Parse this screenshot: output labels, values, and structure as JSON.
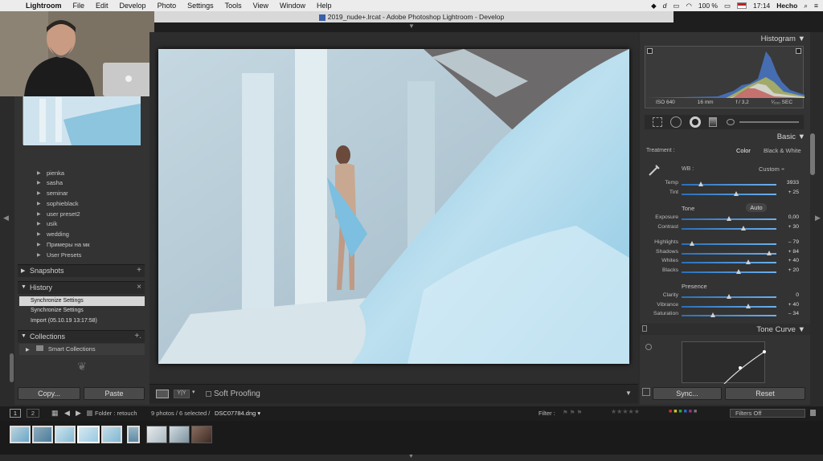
{
  "menubar": {
    "items": [
      "Lightroom",
      "File",
      "Edit",
      "Develop",
      "Photo",
      "Settings",
      "Tools",
      "View",
      "Window",
      "Help"
    ],
    "battery": "100 %",
    "time": "17:14",
    "user": "Hecho"
  },
  "window": {
    "title": "2019_nude+.lrcat - Adobe Photoshop Lightroom - Develop"
  },
  "left_panel": {
    "presets": [
      "pienka",
      "sasha",
      "seminar",
      "sophieblack",
      "user preset2",
      "usik",
      "wedding",
      "Примеры на мк",
      "User Presets"
    ],
    "snapshots": {
      "label": "Snapshots",
      "action": "+"
    },
    "history": {
      "label": "History",
      "action": "×",
      "items": [
        "Synchronize Settings",
        "Synchronize Settings",
        "Import (05.10.19 13:17:58)"
      ]
    },
    "collections": {
      "label": "Collections",
      "action": "+.",
      "items": [
        "Smart Collections"
      ]
    },
    "copy_label": "Copy...",
    "paste_label": "Paste"
  },
  "center": {
    "soft_proofing_label": "Soft Proofing",
    "yy_label": "Y|Y"
  },
  "right_panel": {
    "histogram_label": "Histogram",
    "histinfo": [
      "ISO 640",
      "16 mm",
      "f / 3,2",
      "¹⁄₂₀₀ SEC"
    ],
    "basic_label": "Basic",
    "treatment_label": "Treatment :",
    "treatment_color": "Color",
    "treatment_bw": "Black & White",
    "wb_label": "WB :",
    "wb_value": "Custom",
    "tone_label": "Tone",
    "auto_label": "Auto",
    "presence_label": "Presence",
    "tone_curve_label": "Tone Curve",
    "sliders": [
      {
        "name": "Temp",
        "value": "3933",
        "pos": 0.2
      },
      {
        "name": "Tint",
        "value": "+ 25",
        "pos": 0.58
      },
      {
        "name": "Exposure",
        "value": "0,00",
        "pos": 0.5
      },
      {
        "name": "Contrast",
        "value": "+ 30",
        "pos": 0.65
      },
      {
        "name": "Highlights",
        "value": "– 79",
        "pos": 0.11
      },
      {
        "name": "Shadows",
        "value": "+ 84",
        "pos": 0.92
      },
      {
        "name": "Whites",
        "value": "+ 40",
        "pos": 0.7
      },
      {
        "name": "Blacks",
        "value": "+ 20",
        "pos": 0.6
      },
      {
        "name": "Clarity",
        "value": "0",
        "pos": 0.5
      },
      {
        "name": "Vibrance",
        "value": "+ 40",
        "pos": 0.7
      },
      {
        "name": "Saturation",
        "value": "– 34",
        "pos": 0.33
      }
    ],
    "sync_label": "Sync...",
    "reset_label": "Reset"
  },
  "filmstrip": {
    "page1": "1",
    "page2": "2",
    "folder": "Folder : retouch",
    "count": "9 photos / 6 selected /",
    "filename": "DSC07784.dng",
    "filter_label": "Filter :",
    "filters_off": "Filters Off"
  }
}
